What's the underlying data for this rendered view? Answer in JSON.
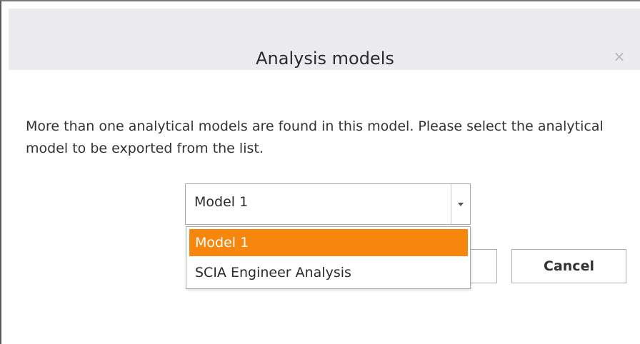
{
  "dialog": {
    "title": "Analysis models",
    "close_glyph": "×",
    "message": "More than one analytical models are found in this model. Please select the analytical model to be exported from the list."
  },
  "model_select": {
    "value": "Model 1",
    "arrow_icon": "chevron-down-icon",
    "options": [
      {
        "label": "Model 1",
        "selected": true
      },
      {
        "label": "SCIA Engineer Analysis",
        "selected": false
      }
    ]
  },
  "buttons": {
    "ok_label": "",
    "cancel_label": "Cancel"
  },
  "colors": {
    "titlebar_bg": "#ececf0",
    "selection_highlight": "#f7870c"
  }
}
